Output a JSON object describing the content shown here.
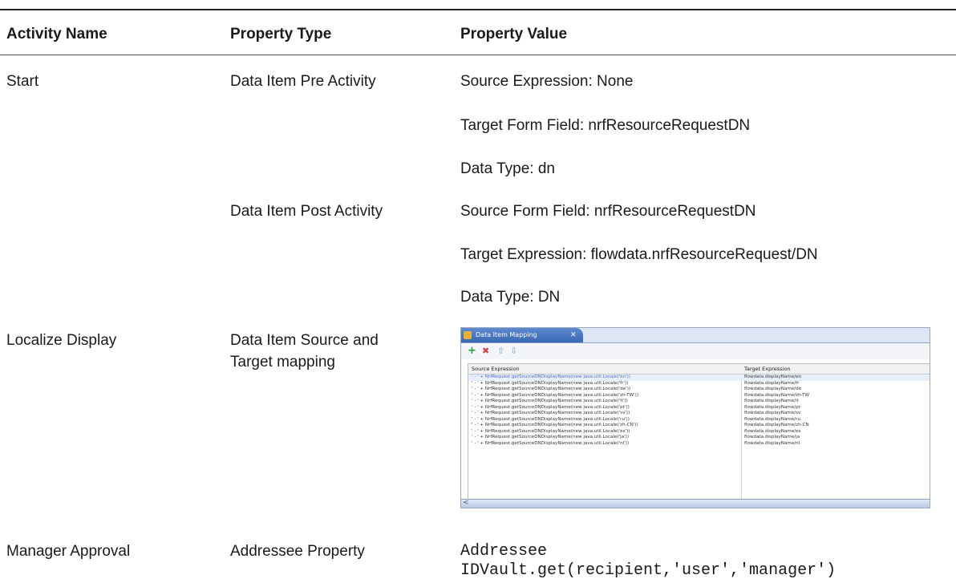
{
  "table": {
    "headers": [
      "Activity Name",
      "Property Type",
      "Property Value"
    ],
    "rows": [
      {
        "activity": "Start",
        "type": "Data Item Pre Activity",
        "values": [
          "Source Expression: None",
          "Target Form Field: nrfResourceRequestDN",
          "Data Type: dn"
        ]
      },
      {
        "activity": "",
        "type": "Data Item Post Activity",
        "values": [
          "Source Form Field: nrfResourceRequestDN",
          "Target Expression: flowdata.nrfResourceRequest/DN",
          "Data Type: DN"
        ]
      },
      {
        "activity": "Localize Display",
        "type_lines": [
          "Data Item Source and",
          "Target mapping"
        ]
      },
      {
        "activity": "Manager Approval",
        "type": "Addressee Property",
        "value_lines": [
          "Addressee",
          "IDVault.get(recipient,'user','manager')"
        ]
      }
    ]
  },
  "screenshot": {
    "tab_label": "Data Item Mapping",
    "tab_close": "✕",
    "toolbar": {
      "add": "+",
      "delete": "✖",
      "up": "⇧",
      "down": "⇩"
    },
    "col_source": "Source Expression",
    "col_target": "Target Expression",
    "scroll_arrow": "<",
    "mappings": [
      {
        "s": "' - ' + NrfRequest.getSourceDNDisplayName(new java.util.Locale('en'))",
        "t": "flowdata.displayName/en"
      },
      {
        "s": "' - ' + NrfRequest.getSourceDNDisplayName(new java.util.Locale('fr'))",
        "t": "flowdata.displayName/fr"
      },
      {
        "s": "' - ' + NrfRequest.getSourceDNDisplayName(new java.util.Locale('de'))",
        "t": "flowdata.displayName/de"
      },
      {
        "s": "' - ' + NrfRequest.getSourceDNDisplayName(new java.util.Locale('zh-TW'))",
        "t": "flowdata.displayName/zh-TW"
      },
      {
        "s": "' - ' + NrfRequest.getSourceDNDisplayName(new java.util.Locale('it'))",
        "t": "flowdata.displayName/it"
      },
      {
        "s": "' - ' + NrfRequest.getSourceDNDisplayName(new java.util.Locale('pt'))",
        "t": "flowdata.displayName/pt"
      },
      {
        "s": "' - ' + NrfRequest.getSourceDNDisplayName(new java.util.Locale('sv'))",
        "t": "flowdata.displayName/sv"
      },
      {
        "s": "' - ' + NrfRequest.getSourceDNDisplayName(new java.util.Locale('ru'))",
        "t": "flowdata.displayName/ru"
      },
      {
        "s": "' - ' + NrfRequest.getSourceDNDisplayName(new java.util.Locale('zh-CN'))",
        "t": "flowdata.displayName/zh-CN"
      },
      {
        "s": "' - ' + NrfRequest.getSourceDNDisplayName(new java.util.Locale('es'))",
        "t": "flowdata.displayName/es"
      },
      {
        "s": "' - ' + NrfRequest.getSourceDNDisplayName(new java.util.Locale('ja'))",
        "t": "flowdata.displayName/ja"
      },
      {
        "s": "' - ' + NrfRequest.getSourceDNDisplayName(new java.util.Locale('nl'))",
        "t": "flowdata.displayName/nl"
      }
    ]
  }
}
